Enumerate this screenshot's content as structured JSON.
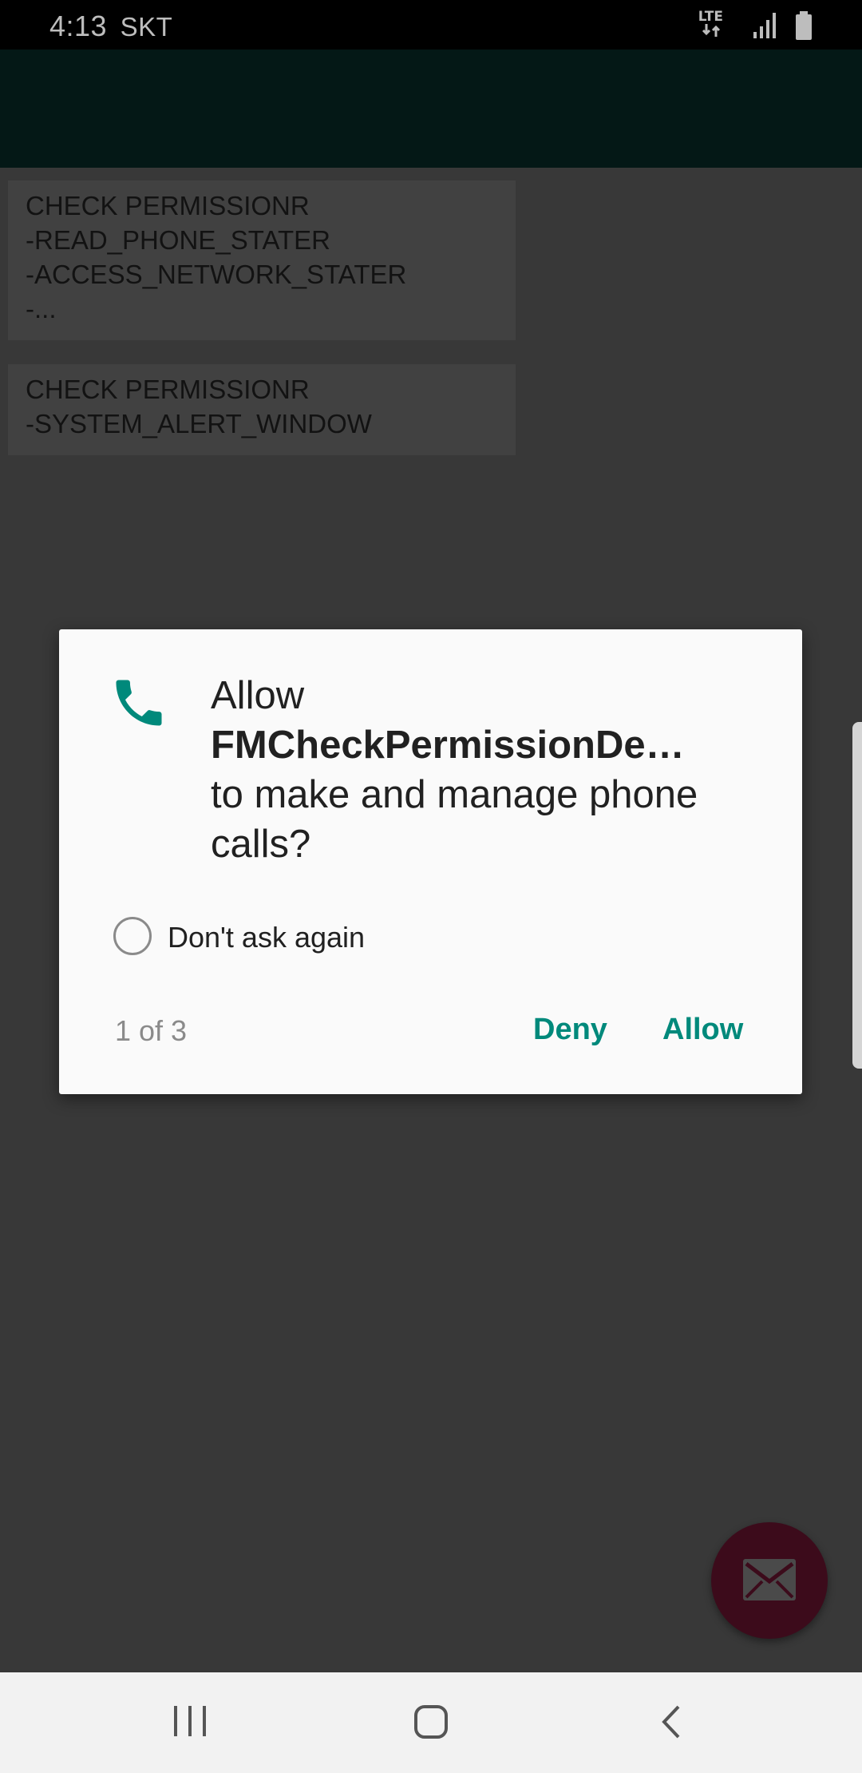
{
  "status_bar": {
    "time": "4:13",
    "carrier": "SKT",
    "network": "LTE",
    "icons": [
      "lte-icon",
      "signal-icon",
      "battery-icon"
    ]
  },
  "buttons": [
    {
      "lines": [
        "CHECK PERMISSIONR",
        "-READ_PHONE_STATER",
        "-ACCESS_NETWORK_STATER",
        "-..."
      ]
    },
    {
      "lines": [
        "CHECK PERMISSIONR",
        "-SYSTEM_ALERT_WINDOW"
      ]
    }
  ],
  "dialog": {
    "icon": "phone-icon",
    "title_prefix": "Allow",
    "app_name": "FMCheckPermissionDe…",
    "title_suffix": "to make and manage phone calls?",
    "checkbox_label": "Don't ask again",
    "page_count": "1 of 3",
    "deny_label": "Deny",
    "allow_label": "Allow"
  },
  "fab": {
    "icon": "mail-icon"
  },
  "nav_bar": {
    "icons": [
      "recent-apps-icon",
      "home-icon",
      "back-icon"
    ]
  },
  "colors": {
    "accent": "#00897b",
    "app_bar": "#041816",
    "scrim": "#383838",
    "fab": "#3c0b1b"
  }
}
